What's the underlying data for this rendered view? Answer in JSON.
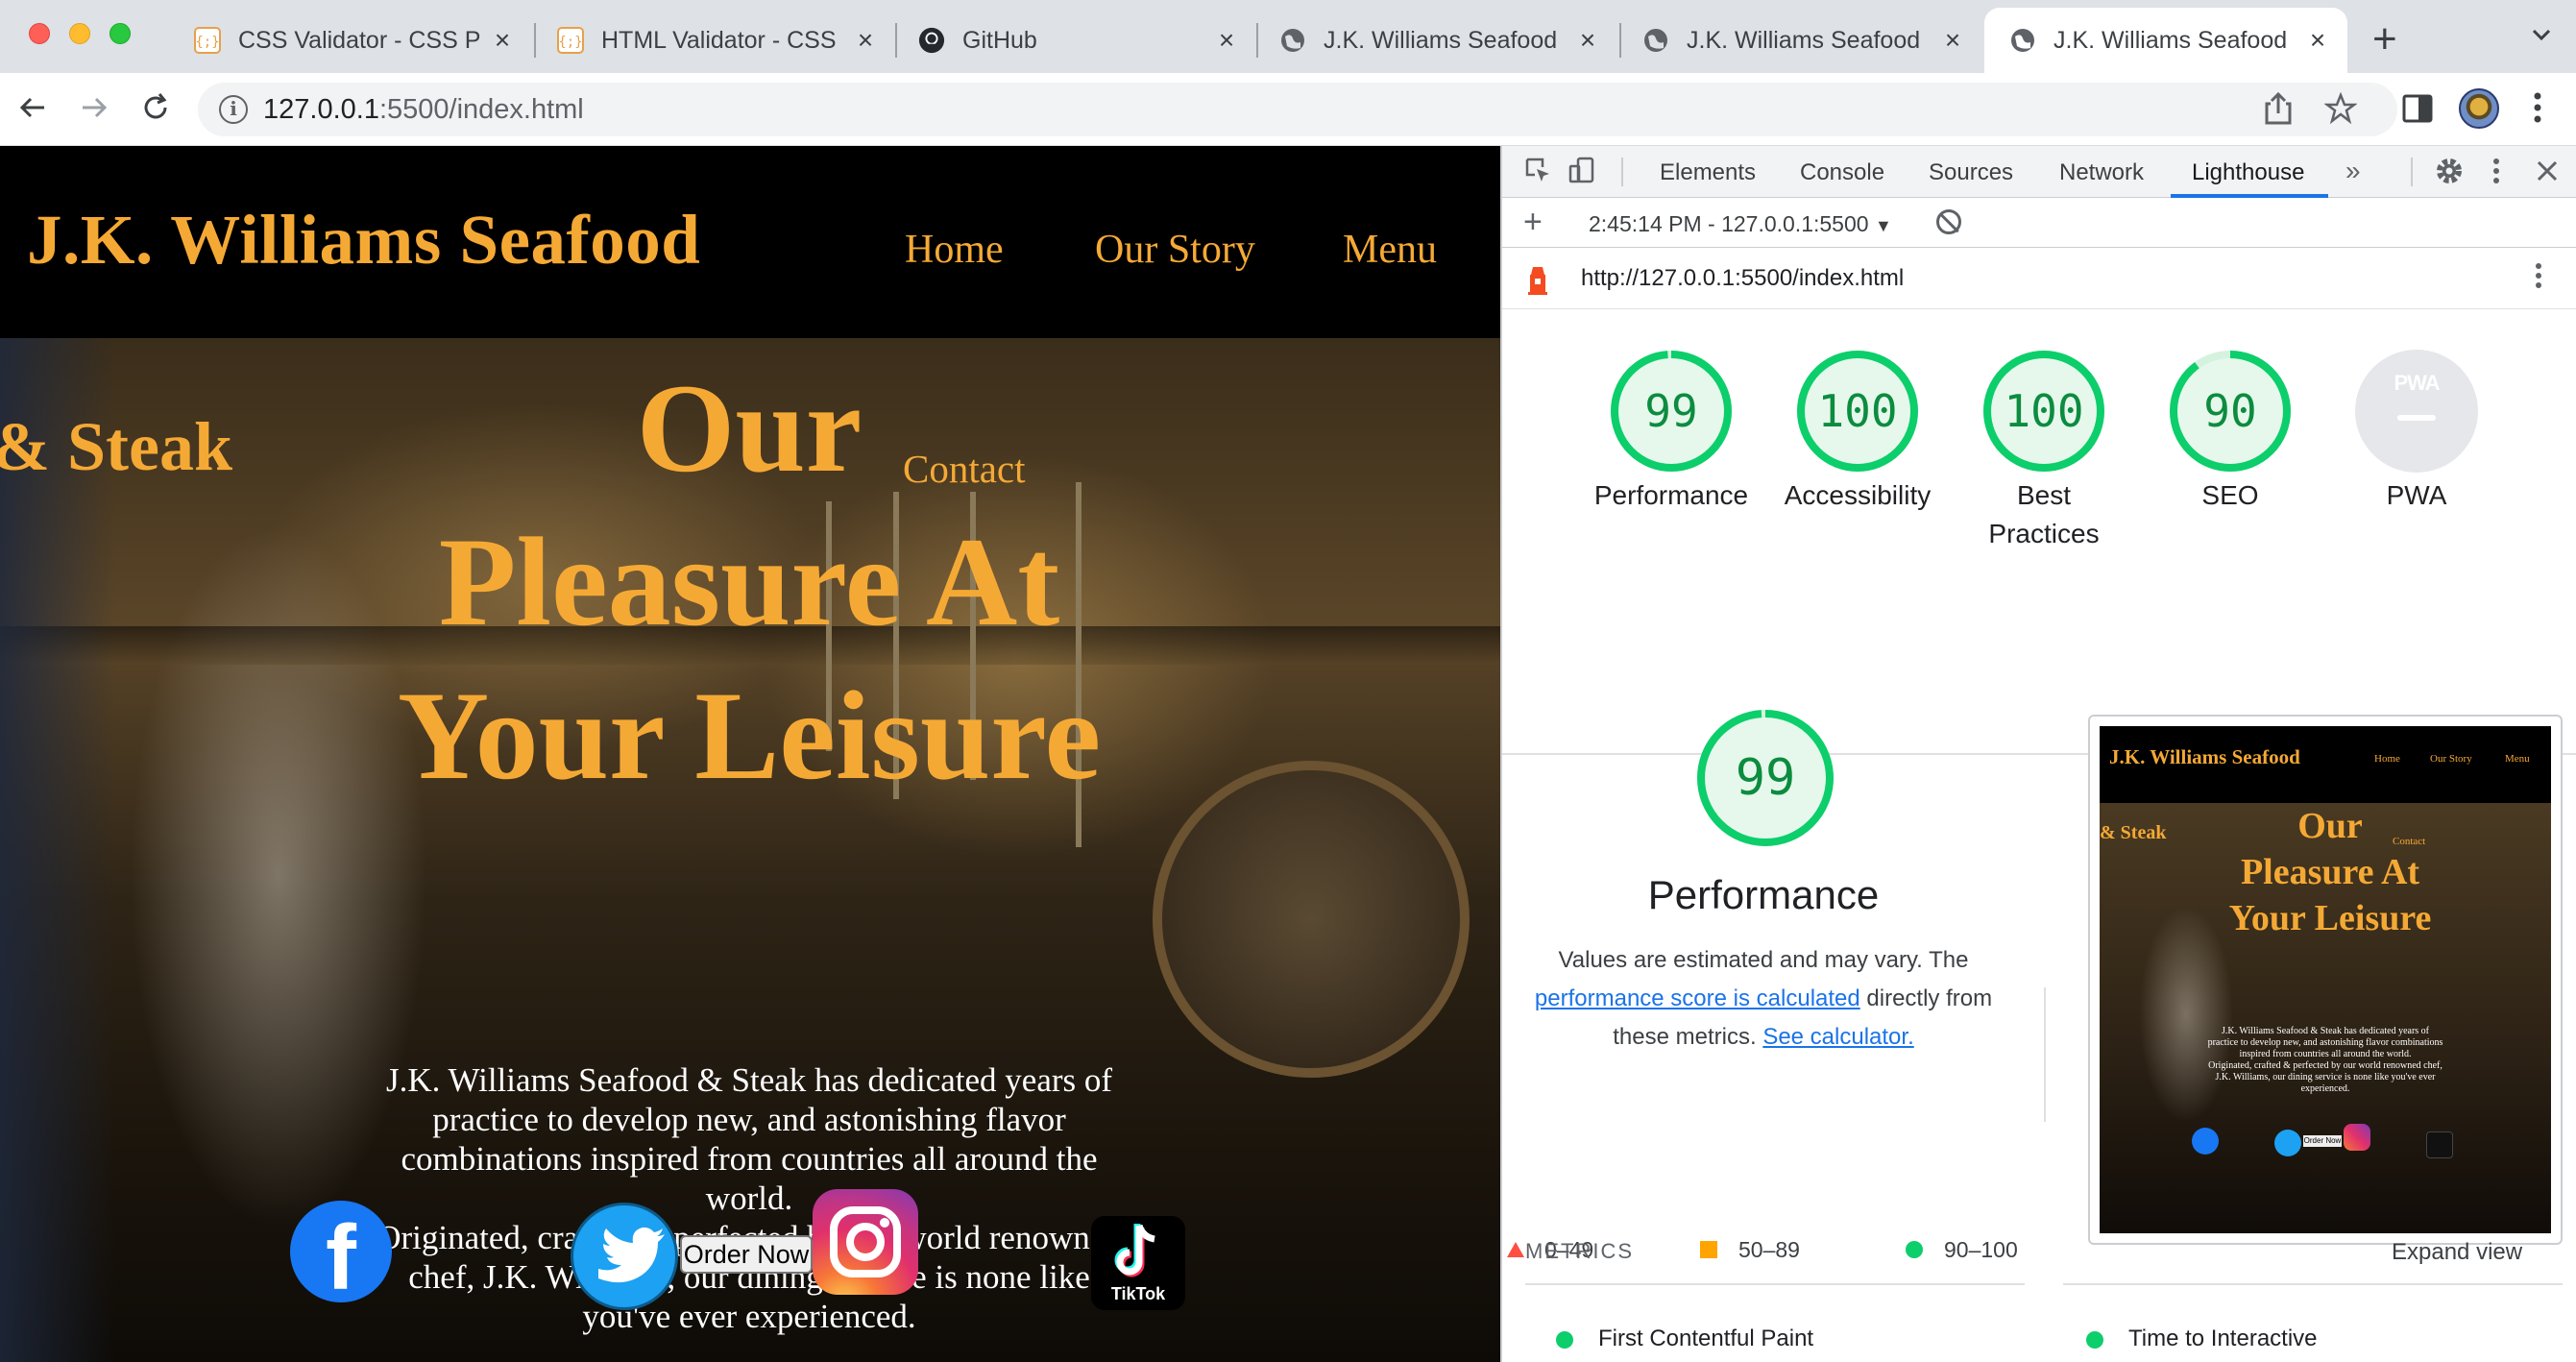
{
  "browser": {
    "tabs": [
      {
        "title": "CSS Validator - CSS P",
        "icon": "validator-icon",
        "active": false
      },
      {
        "title": "HTML Validator - CSS",
        "icon": "validator-icon",
        "active": false
      },
      {
        "title": "GitHub",
        "icon": "github-icon",
        "active": false
      },
      {
        "title": "J.K. Williams Seafood",
        "icon": "globe-icon",
        "active": false
      },
      {
        "title": "J.K. Williams Seafood",
        "icon": "globe-icon",
        "active": false
      },
      {
        "title": "J.K. Williams Seafood",
        "icon": "globe-icon",
        "active": true
      }
    ],
    "url_host": "127.0.0.1",
    "url_rest": ":5500/index.html",
    "colors": {
      "tabstrip": "#dee1e6",
      "link": "#1a73e8"
    }
  },
  "site": {
    "brand": "J.K. Williams Seafood",
    "nav": [
      "Home",
      "Our Story",
      "Menu"
    ],
    "steak_fragment": "& Steak",
    "contact": "Contact",
    "hero_title_lines": [
      "Our",
      "Pleasure At",
      "Your Leisure"
    ],
    "paragraph1": "J.K. Williams Seafood & Steak has dedicated years of practice to develop new, and astonishing flavor combinations inspired from countries all around the world.",
    "paragraph2": "Originated, crafted & perfected by our world renowned chef, J.K. Williams, our dining service is none like you've ever experienced.",
    "order_button": "Order Now",
    "tiktok_label": "TikTok",
    "accent_color": "#f5a935"
  },
  "devtools": {
    "tabs": [
      "Elements",
      "Console",
      "Sources",
      "Network",
      "Lighthouse"
    ],
    "active_tab": "Lighthouse",
    "session": "2:45:14 PM - 127.0.0.1:5500",
    "report_url": "http://127.0.0.1:5500/index.html",
    "scores": [
      {
        "label_line1": "Performance",
        "label_line2": "",
        "value": 99
      },
      {
        "label_line1": "Accessibility",
        "label_line2": "",
        "value": 100
      },
      {
        "label_line1": "Best",
        "label_line2": "Practices",
        "value": 100
      },
      {
        "label_line1": "SEO",
        "label_line2": "",
        "value": 90
      }
    ],
    "pwa": {
      "label": "PWA",
      "badge": "PWA"
    },
    "performance": {
      "score": 99,
      "title": "Performance",
      "desc_before": "Values are estimated and may vary. The",
      "link1": "performance score is calculated",
      "desc_middle": "directly from these metrics.",
      "link2": "See calculator."
    },
    "legend": [
      "0–49",
      "50–89",
      "90–100"
    ],
    "thumbnail": {
      "brand": "J.K. Williams Seafood",
      "nav": [
        "Home",
        "Our Story",
        "Menu"
      ],
      "steak_fragment": "& Steak",
      "contact": "Contact",
      "title_lines": [
        "Our",
        "Pleasure At",
        "Your Leisure"
      ],
      "order_button": "Order Now"
    },
    "metrics_heading": "METRICS",
    "expand_view": "Expand view",
    "metrics": [
      "First Contentful Paint",
      "Time to Interactive"
    ],
    "colors": {
      "pass": "#0cce6b",
      "average": "#ffa400",
      "fail": "#ff4e42"
    }
  }
}
